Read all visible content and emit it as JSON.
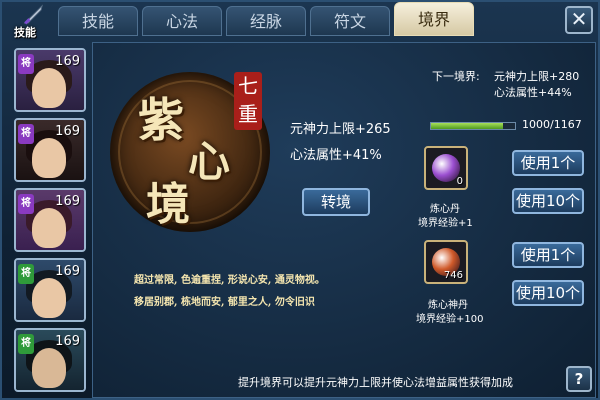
{
  "header": {
    "logo_label": "技能",
    "tabs": [
      "技能",
      "心法",
      "经脉",
      "符文",
      "境界"
    ],
    "active_tab": "境界",
    "close_glyph": "✕"
  },
  "heroes": [
    {
      "level": "169",
      "tag": "将"
    },
    {
      "level": "169",
      "tag": "将"
    },
    {
      "level": "169",
      "tag": "将"
    },
    {
      "level": "169",
      "tag": "将"
    },
    {
      "level": "169",
      "tag": "将"
    }
  ],
  "realm": {
    "name_chars": [
      "紫",
      "心",
      "境"
    ],
    "rank_badge": "七重",
    "stat_power": "元神力上限+265",
    "stat_attr": "心法属性+41%",
    "advance_button": "转境",
    "lore_line1": "超过常限, 色逾重捏, 形说心安, 通灵物视。",
    "lore_line2": "移居别郡, 栋地而安, 郁里之人, 勿令旧识"
  },
  "next": {
    "label": "下一境界:",
    "power": "元神力上限+280",
    "attr": "心法属性+44%",
    "progress_text": "1000/1167",
    "progress": 0.857
  },
  "items": [
    {
      "name": "炼心丹",
      "effect": "境界经验+1",
      "count": "0",
      "orb_color": "#9b4fd0",
      "use1": "使用1个",
      "use10": "使用10个"
    },
    {
      "name": "炼心神丹",
      "effect": "境界经验+100",
      "count": "746",
      "orb_color": "#d05a2a",
      "use1": "使用1个",
      "use10": "使用10个"
    }
  ],
  "footer": {
    "hint": "提升境界可以提升元神力上限并使心法增益属性获得加成",
    "help_glyph": "?"
  }
}
